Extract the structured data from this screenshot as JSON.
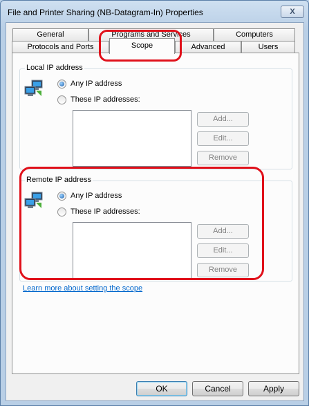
{
  "window": {
    "title": "File and Printer Sharing (NB-Datagram-In) Properties",
    "close_glyph": "X"
  },
  "tabs": {
    "row1": [
      "General",
      "Programs and Services",
      "Computers"
    ],
    "row2": [
      "Protocols and Ports",
      "Scope",
      "Advanced",
      "Users"
    ],
    "active": "Scope"
  },
  "local": {
    "group_label": "Local IP address",
    "any_label": "Any IP address",
    "these_label": "These IP addresses:",
    "selected": "any",
    "add_label": "Add...",
    "edit_label": "Edit...",
    "remove_label": "Remove"
  },
  "remote": {
    "group_label": "Remote IP address",
    "any_label": "Any IP address",
    "these_label": "These IP addresses:",
    "selected": "any",
    "add_label": "Add...",
    "edit_label": "Edit...",
    "remove_label": "Remove"
  },
  "link_text": "Learn more about setting the scope",
  "footer": {
    "ok_label": "OK",
    "cancel_label": "Cancel",
    "apply_label": "Apply"
  },
  "colors": {
    "annotation": "#e0101a",
    "link": "#0066cc",
    "radio_selected": "#1b5da8"
  },
  "icons": [
    "close-icon",
    "network-computers-icon"
  ]
}
